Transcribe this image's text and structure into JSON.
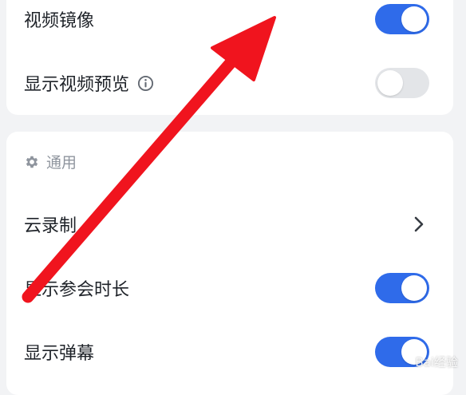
{
  "video_section": {
    "items": [
      {
        "label": "视频镜像",
        "toggle": "on"
      },
      {
        "label": "显示视频预览",
        "toggle": "off",
        "info_icon": "info-icon"
      }
    ]
  },
  "general_section": {
    "header_icon": "gear-icon",
    "header_label": "通用",
    "items": [
      {
        "label": "云录制",
        "control": "chevron-right-icon"
      },
      {
        "label": "显示参会时长",
        "toggle": "on"
      },
      {
        "label": "显示弹幕",
        "toggle": "on"
      }
    ]
  },
  "annotation": {
    "arrow_color": "#f0141e",
    "arrow_icon": "red-arrow-annotation"
  },
  "watermark": "Bai经验"
}
